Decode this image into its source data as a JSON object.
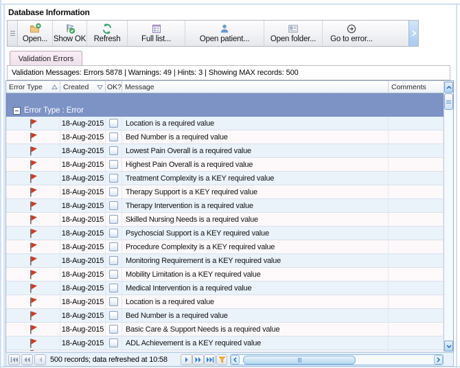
{
  "window": {
    "title": "Database Information"
  },
  "toolbar": {
    "buttons": [
      {
        "label": "Open...",
        "icon": "open-icon"
      },
      {
        "label": "Show OK",
        "icon": "flag-ok-icon"
      },
      {
        "label": "Refresh",
        "icon": "refresh-icon"
      },
      {
        "label": "Full list...",
        "icon": "full-list-icon"
      },
      {
        "label": "Open patient...",
        "icon": "patient-icon"
      },
      {
        "label": "Open folder...",
        "icon": "folder-card-icon"
      },
      {
        "label": "Go to error...",
        "icon": "goto-error-icon"
      }
    ]
  },
  "tabs": [
    {
      "label": "Validation Errors",
      "active": true
    }
  ],
  "summary": {
    "text": "Validation Messages: Errors 5878 | Warnings: 49 | Hints: 3 | Showing MAX records: 500"
  },
  "grid": {
    "columns": [
      "Error Type",
      "Created",
      "OK?",
      "Message",
      "Comments"
    ],
    "sort_column": "Error Type",
    "group_label": "Error Type : Error",
    "rows": [
      {
        "created": "18-Aug-2015",
        "message": "Location is a required value"
      },
      {
        "created": "18-Aug-2015",
        "message": "Bed Number is a required value"
      },
      {
        "created": "18-Aug-2015",
        "message": "Lowest Pain Overall is a required value"
      },
      {
        "created": "18-Aug-2015",
        "message": "Highest Pain Overall is a required value"
      },
      {
        "created": "18-Aug-2015",
        "message": "Treatment Complexity is a KEY required value"
      },
      {
        "created": "18-Aug-2015",
        "message": "Therapy Support is a KEY required value"
      },
      {
        "created": "18-Aug-2015",
        "message": "Therapy Intervention is a required value"
      },
      {
        "created": "18-Aug-2015",
        "message": "Skilled Nursing Needs is a required value"
      },
      {
        "created": "18-Aug-2015",
        "message": "Psychoscial Support is a KEY required value"
      },
      {
        "created": "18-Aug-2015",
        "message": "Procedure Complexity is a KEY required value"
      },
      {
        "created": "18-Aug-2015",
        "message": "Monitoring Requirement is a KEY required value"
      },
      {
        "created": "18-Aug-2015",
        "message": "Mobility Limitation is a KEY required value"
      },
      {
        "created": "18-Aug-2015",
        "message": "Medical Intervention is a required value"
      },
      {
        "created": "18-Aug-2015",
        "message": "Location is a required value"
      },
      {
        "created": "18-Aug-2015",
        "message": "Bed Number is a required value"
      },
      {
        "created": "18-Aug-2015",
        "message": "Basic Care & Support Needs is a required value"
      },
      {
        "created": "18-Aug-2015",
        "message": "ADL Achievement is a KEY required value"
      }
    ]
  },
  "statusbar": {
    "text": "500 records; data refreshed at 10:58"
  }
}
